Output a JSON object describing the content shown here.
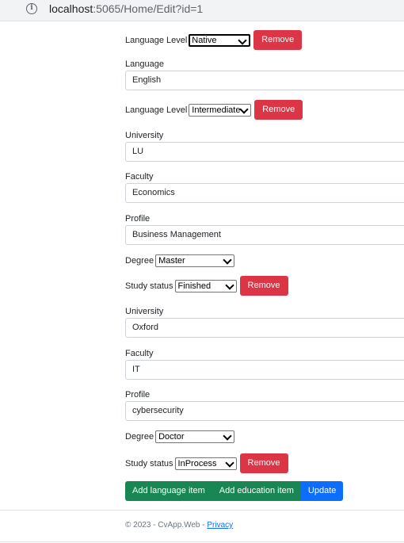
{
  "browser": {
    "url_host": "localhost",
    "url_rest": ":5065/Home/Edit?id=1"
  },
  "form": {
    "lang1": {
      "level_label": "Language Level",
      "level_value": "Native",
      "remove_label": "Remove"
    },
    "lang2": {
      "language_label": "Language",
      "language_value": "English",
      "level_label": "Language Level",
      "level_value": "Intermediate",
      "remove_label": "Remove"
    },
    "edu1": {
      "university_label": "University",
      "university_value": "LU",
      "faculty_label": "Faculty",
      "faculty_value": "Economics",
      "profile_label": "Profile",
      "profile_value": "Business Management",
      "degree_label": "Degree",
      "degree_value": "Master",
      "status_label": "Study status",
      "status_value": "Finished",
      "remove_label": "Remove"
    },
    "edu2": {
      "university_label": "University",
      "university_value": "Oxford",
      "faculty_label": "Faculty",
      "faculty_value": "IT",
      "profile_label": "Profile",
      "profile_value": "cybersecurity",
      "degree_label": "Degree",
      "degree_value": "Doctor",
      "status_label": "Study status",
      "status_value": "InProcess",
      "remove_label": "Remove"
    }
  },
  "actions": {
    "add_language": "Add language item",
    "add_education": "Add education item",
    "update": "Update"
  },
  "footer": {
    "text": "© 2023 - CvApp.Web - ",
    "privacy": "Privacy"
  },
  "colors": {
    "danger": "#dc3545",
    "success": "#198754",
    "primary": "#0d6efd"
  }
}
